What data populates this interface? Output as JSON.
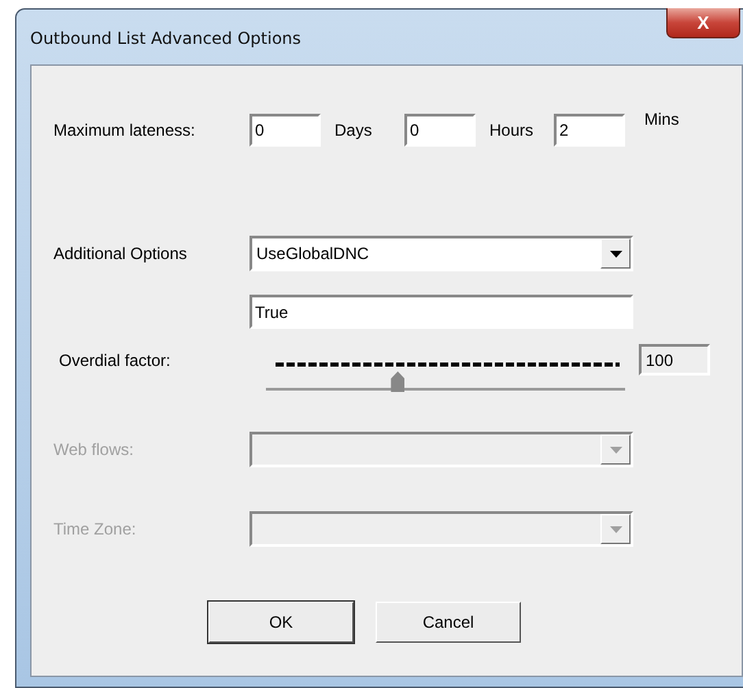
{
  "window": {
    "title": "Outbound List Advanced Options",
    "close_label": "X"
  },
  "lateness": {
    "label": "Maximum lateness:",
    "fields": [
      {
        "value": "0",
        "unit": "Days"
      },
      {
        "value": "0",
        "unit": "Hours"
      },
      {
        "value": "2",
        "unit": "Mins"
      }
    ]
  },
  "additional_options": {
    "label": "Additional Options",
    "value": "UseGlobalDNC",
    "text_value": "True"
  },
  "overdial": {
    "label": "Overdial factor:",
    "level": 0.36,
    "reading": "100"
  },
  "dropdowns": [
    {
      "label": "Web flows:",
      "disabled": true
    },
    {
      "label": "Time Zone:",
      "disabled": true
    }
  ],
  "buttons": [
    {
      "label": "OK",
      "default": true
    },
    {
      "label": "Cancel",
      "default": false
    }
  ]
}
